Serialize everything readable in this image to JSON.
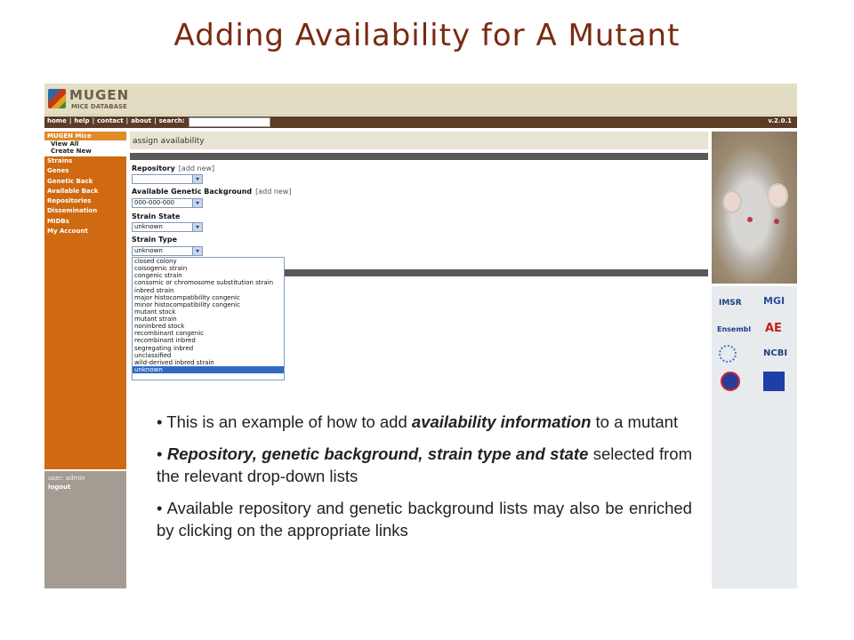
{
  "slide": {
    "title": "Adding Availability for A Mutant"
  },
  "app": {
    "logo_name": "MUGEN",
    "logo_sub": "MICE DATABASE",
    "version": "v.2.0.1"
  },
  "nav": {
    "links": [
      "home",
      "|",
      "help",
      "|",
      "contact",
      "|",
      "about",
      "|",
      "search:"
    ]
  },
  "sidebar": {
    "header": "MUGEN Mice",
    "sub_items": [
      "View All",
      "Create New"
    ],
    "items": [
      "Strains",
      "Genes",
      "Genetic Back",
      "Available Back",
      "Repositories",
      "Dissemination",
      "MIDBs",
      "My Account"
    ],
    "user_label": "user: admin",
    "logout": "logout"
  },
  "page": {
    "heading": "assign availability",
    "repository_label": "Repository",
    "repository_add": "[add new]",
    "background_label": "Available Genetic Background",
    "background_add": "[add new]",
    "background_value": "000-000-000",
    "strain_state_label": "Strain State",
    "strain_state_value": "unknown",
    "strain_type_label": "Strain Type",
    "strain_type_value": "unknown",
    "strain_type_options": [
      "closed colony",
      "coisogenic strain",
      "congenic strain",
      "consomic or chromosome substitution strain",
      "inbred strain",
      "major histocompatibility congenic",
      "minor histocompatibility congenic",
      "mutant stock",
      "mutant strain",
      "noninbred stock",
      "recombinant congenic",
      "recombinant inbred",
      "segregating inbred",
      "unclassified",
      "wild-derived inbred strain",
      "unknown"
    ],
    "selected_option_index": 15
  },
  "partners": [
    "IMSR",
    "MGI",
    "Ensembl",
    "AE",
    "NCBI"
  ],
  "bullets": {
    "b1_pre": "This is an example of how to add ",
    "b1_em": "availability information",
    "b1_post": " to a mutant",
    "b2_em": "Repository, genetic background, strain type and state",
    "b2_post": " selected from the relevant drop-down lists",
    "b3": "Available repository and genetic background lists may also be enriched by clicking on the appropriate links"
  },
  "colors": {
    "title": "#7a2a12",
    "sidebar": "#cf6a12",
    "navbar": "#5b3c27",
    "selected_option": "#316ac5"
  }
}
